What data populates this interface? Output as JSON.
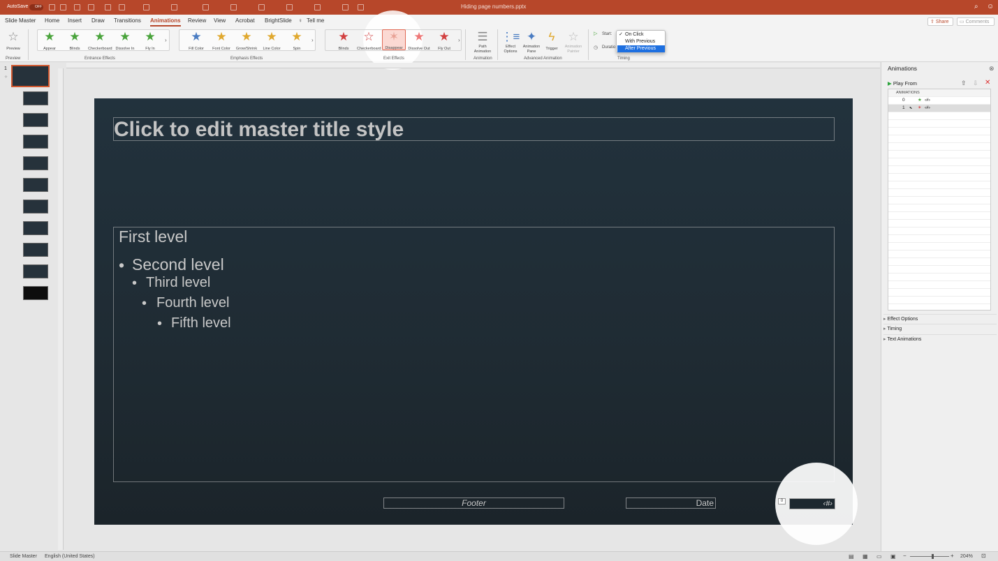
{
  "titlebar": {
    "autosave": "AutoSave",
    "autosave_state": "OFF",
    "doc_title": "Hiding page numbers.pptx"
  },
  "tabs": [
    "Slide Master",
    "Home",
    "Insert",
    "Draw",
    "Transitions",
    "Animations",
    "Review",
    "View",
    "Acrobat",
    "BrightSlide"
  ],
  "tell_me": "Tell me",
  "share": "Share",
  "comments": "Comments",
  "ribbon": {
    "preview": "Preview",
    "preview_group": "Preview",
    "entrance": [
      "Appear",
      "Blinds",
      "Checkerboard",
      "Dissolve In",
      "Fly In"
    ],
    "entrance_group": "Entrance Effects",
    "emphasis": [
      "Fill Color",
      "Font Color",
      "Grow/Shrink",
      "Line Color",
      "Spin"
    ],
    "emphasis_group": "Emphasis Effects",
    "exit": [
      "Blinds",
      "Checkerboard",
      "Disappear",
      "Dissolve Out",
      "Fly Out"
    ],
    "exit_group": "Exit Effects",
    "path_animation": "Path Animation",
    "animation_group": "Animation",
    "effect_options": "Effect Options",
    "animation_pane": "Animation Pane",
    "trigger": "Trigger",
    "animation_painter": "Animation Painter",
    "advanced_group": "Advanced Animation",
    "start_label": "Start:",
    "duration_label": "Duratio",
    "timing_group": "Timing"
  },
  "start_dropdown": {
    "options": [
      "On Click",
      "With Previous",
      "After Previous"
    ],
    "checked": "On Click",
    "highlighted": "After Previous"
  },
  "slide_number": "1",
  "slide": {
    "title": "Click to edit master title style",
    "levels": [
      "First level",
      "Second level",
      "Third level",
      "Fourth level",
      "Fifth level"
    ],
    "footer": "Footer",
    "date": "Date",
    "page_number": "‹#›",
    "anim_tag": "0"
  },
  "pane": {
    "title": "Animations",
    "play_from": "Play From",
    "list_header": "ANIMATIONS",
    "rows": [
      {
        "num": "0",
        "label": "‹#›"
      },
      {
        "num": "1",
        "label": "‹#›"
      }
    ],
    "sections": [
      "Effect Options",
      "Timing",
      "Text Animations"
    ]
  },
  "status": {
    "view": "Slide Master",
    "language": "English (United States)",
    "zoom": "204%"
  }
}
